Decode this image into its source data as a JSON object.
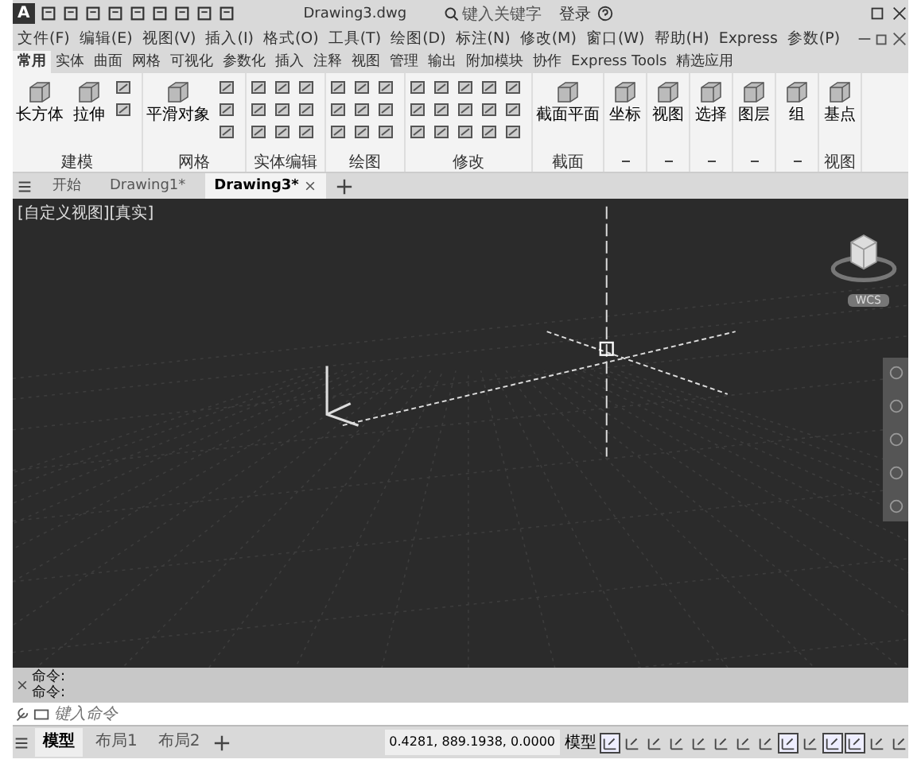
{
  "title_bar": {
    "app_button": "A",
    "title": "Drawing3.dwg",
    "search_placeholder": "键入关键字",
    "sign_in": "登录"
  },
  "menu_bar": [
    "文件(F)",
    "编辑(E)",
    "视图(V)",
    "插入(I)",
    "格式(O)",
    "工具(T)",
    "绘图(D)",
    "标注(N)",
    "修改(M)",
    "窗口(W)",
    "帮助(H)",
    "Express",
    "参数(P)"
  ],
  "ribbon_tabs": [
    {
      "label": "常用",
      "selected": true
    },
    {
      "label": "实体",
      "selected": false
    },
    {
      "label": "曲面",
      "selected": false
    },
    {
      "label": "网格",
      "selected": false
    },
    {
      "label": "可视化",
      "selected": false
    },
    {
      "label": "参数化",
      "selected": false
    },
    {
      "label": "插入",
      "selected": false
    },
    {
      "label": "注释",
      "selected": false
    },
    {
      "label": "视图",
      "selected": false
    },
    {
      "label": "管理",
      "selected": false
    },
    {
      "label": "输出",
      "selected": false
    },
    {
      "label": "附加模块",
      "selected": false
    },
    {
      "label": "协作",
      "selected": false
    },
    {
      "label": "Express Tools",
      "selected": false
    },
    {
      "label": "精选应用",
      "selected": false
    }
  ],
  "ribbon_panels": [
    {
      "title": "建模",
      "large_tools": [
        "长方体",
        "拉伸"
      ]
    },
    {
      "title": "网格",
      "large_tools": [
        "平滑对象"
      ]
    },
    {
      "title": "实体编辑"
    },
    {
      "title": "绘图"
    },
    {
      "title": "修改"
    },
    {
      "title": "截面",
      "large_tools": [
        "截面平面"
      ]
    },
    {
      "large_tools": [
        "坐标"
      ]
    },
    {
      "large_tools": [
        "视图"
      ]
    },
    {
      "large_tools": [
        "选择"
      ]
    },
    {
      "large_tools": [
        "图层"
      ]
    },
    {
      "large_tools": [
        "组"
      ]
    },
    {
      "title": "视图",
      "large_tools": [
        "基点"
      ]
    }
  ],
  "doc_tabs": [
    {
      "label": "开始",
      "selected": false
    },
    {
      "label": "Drawing1*",
      "selected": false
    },
    {
      "label": "Drawing3*",
      "selected": true
    }
  ],
  "viewport": {
    "label": "[自定义视图][真实]",
    "wcs": "WCS"
  },
  "command": {
    "history": [
      "命令:",
      "命令:"
    ],
    "placeholder": "键入命令"
  },
  "status_bar": {
    "layouts": [
      {
        "label": "模型",
        "selected": true
      },
      {
        "label": "布局1",
        "selected": false
      },
      {
        "label": "布局2",
        "selected": false
      }
    ],
    "coordinates": "0.4281, 889.1938, 0.0000",
    "space": "模型",
    "toggles": [
      {
        "on": true
      },
      {
        "on": false
      },
      {
        "on": false
      },
      {
        "on": false
      },
      {
        "on": false
      },
      {
        "on": false
      },
      {
        "on": false
      },
      {
        "on": false
      },
      {
        "on": true
      },
      {
        "on": false
      },
      {
        "on": true
      },
      {
        "on": true
      },
      {
        "on": false
      },
      {
        "on": false
      }
    ]
  }
}
